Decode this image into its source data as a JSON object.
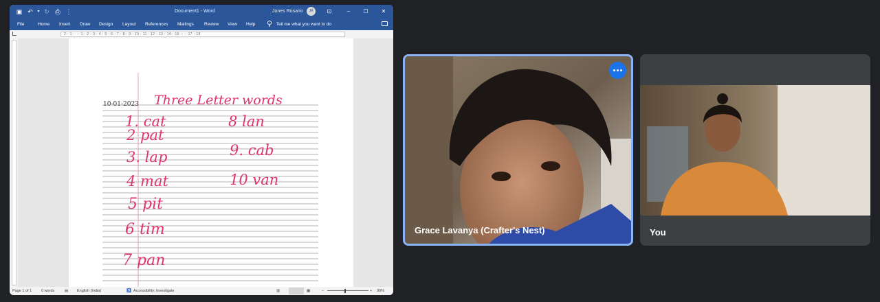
{
  "word": {
    "title": "Document1 - Word",
    "user": "Jones Rosario",
    "user_initials": "JR",
    "tabs": [
      "File",
      "Home",
      "Insert",
      "Draw",
      "Design",
      "Layout",
      "References",
      "Mailings",
      "Review",
      "View",
      "Help"
    ],
    "tellme": "Tell me what you want to do",
    "ruler_text": "·2·:·1·:·  ·:·1·:·2·:·3·:·4·:·5·:·6·:·7·:·8·:·9·:·10·:·11·:·12·:·13·:·14·:·15·:·    ·:·17·:·18·",
    "status": {
      "page": "Page 1 of 1",
      "words": "0 words",
      "language": "English (India)",
      "accessibility": "Accessibility: Investigate",
      "zoom": "90%"
    }
  },
  "notebook": {
    "date": "10-01-2023",
    "heading": "Three Letter words",
    "left_column": [
      "1. cat",
      "2 pat",
      "3. lap",
      "4 mat",
      "5 pit",
      "6 tim",
      "7 pan"
    ],
    "right_column": [
      "8 lan",
      "9. cab",
      "10 van"
    ]
  },
  "meet": {
    "participants": [
      {
        "name": "Grace Lavanya (Crafter's Nest)"
      },
      {
        "name": "You"
      }
    ]
  },
  "colors": {
    "word_blue": "#2b579a",
    "ink": "#e0336f",
    "meet_bg": "#202124",
    "active_border": "#8ab4f8"
  }
}
